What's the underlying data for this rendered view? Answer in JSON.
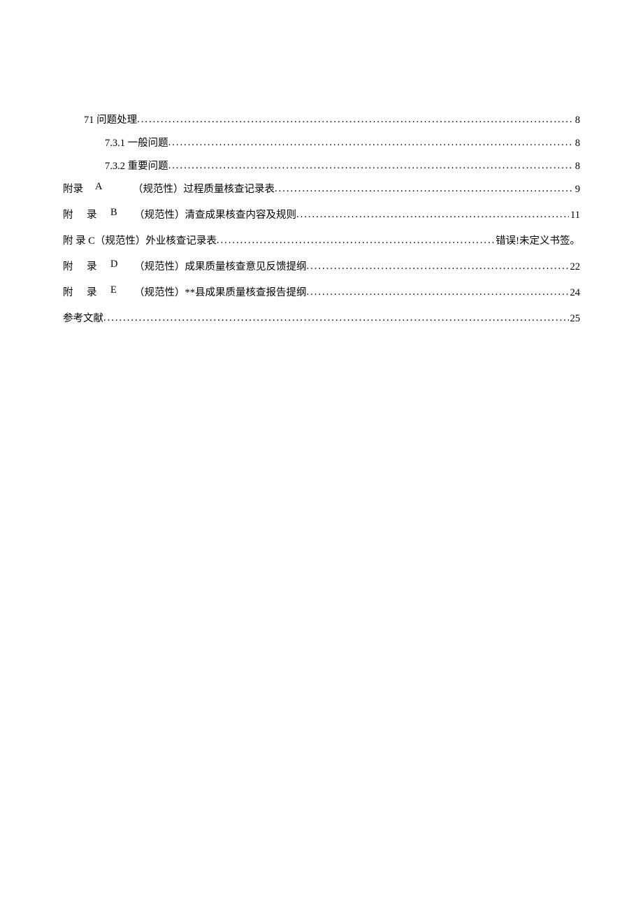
{
  "toc": {
    "l0": {
      "title": "71 问题处理",
      "page": "8"
    },
    "l1": {
      "title": "7.3.1 一般问题",
      "page": "8"
    },
    "l2": {
      "title": "7.3.2 重要问题",
      "page": "8"
    },
    "l3": {
      "tag_a": "附录",
      "tag_b": "A",
      "desc": "（规范性）过程质量核查记录表",
      "page": "9"
    },
    "l4": {
      "tag_a": "附",
      "tag_mid": "录",
      "tag_b": "B",
      "desc": "（规范性）清查成果核查内容及规则",
      "page": "11"
    },
    "l5": {
      "title": "附 录 C（规范性）外业核查记录表",
      "page": "错误!未定义书签。"
    },
    "l6": {
      "tag_a": "附",
      "tag_mid": "录",
      "tag_b": "D",
      "desc": "（规范性）成果质量核查意见反馈提纲",
      "page": "22"
    },
    "l7": {
      "tag_a": "附",
      "tag_mid": "录",
      "tag_b": "E",
      "desc": "（规范性）**县成果质量核查报告提纲",
      "page": "24"
    },
    "l8": {
      "title": "参考文献",
      "page": "25"
    }
  }
}
